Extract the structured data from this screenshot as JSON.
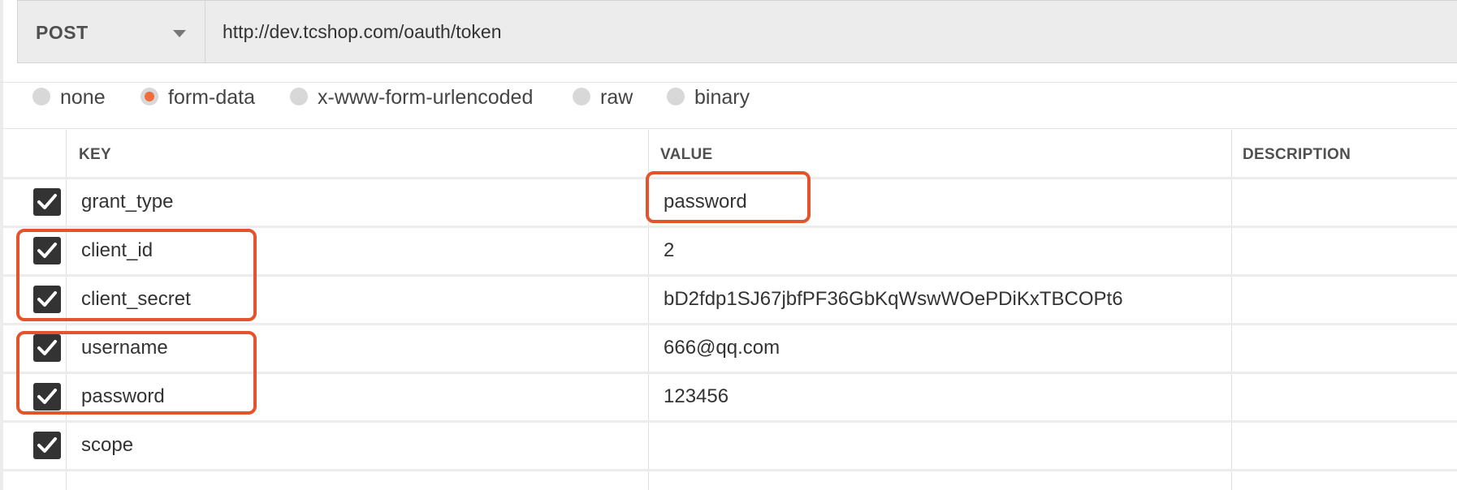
{
  "request": {
    "method": "POST",
    "url": "http://dev.tcshop.com/oauth/token"
  },
  "body_types": [
    {
      "label": "none",
      "selected": false
    },
    {
      "label": "form-data",
      "selected": true
    },
    {
      "label": "x-www-form-urlencoded",
      "selected": false
    },
    {
      "label": "raw",
      "selected": false
    },
    {
      "label": "binary",
      "selected": false
    }
  ],
  "table": {
    "headers": {
      "key": "KEY",
      "value": "VALUE",
      "description": "DESCRIPTION"
    },
    "rows": [
      {
        "key": "grant_type",
        "value": "password",
        "description": "",
        "checked": true
      },
      {
        "key": "client_id",
        "value": "2",
        "description": "",
        "checked": true
      },
      {
        "key": "client_secret",
        "value": "bD2fdp1SJ67jbfPF36GbKqWswWOePDiKxTBCOPt6",
        "description": "",
        "checked": true
      },
      {
        "key": "username",
        "value": "666@qq.com",
        "description": "",
        "checked": true
      },
      {
        "key": "password",
        "value": "123456",
        "description": "",
        "checked": true
      },
      {
        "key": "scope",
        "value": "",
        "description": "",
        "checked": true
      }
    ]
  },
  "colors": {
    "accent": "#f26b3a",
    "highlight": "#e4532b",
    "checkbox": "#333333"
  }
}
